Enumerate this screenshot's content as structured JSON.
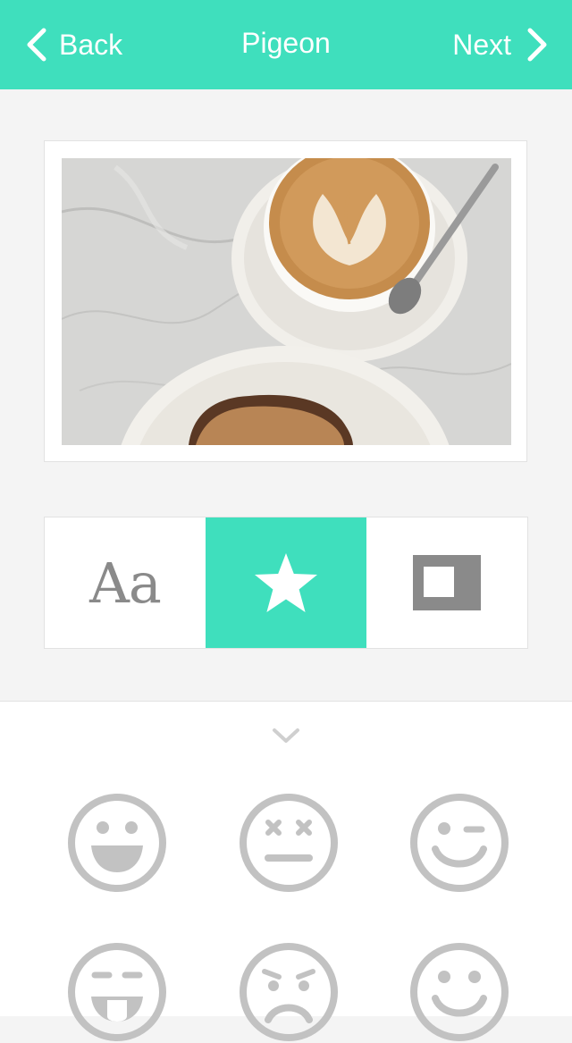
{
  "nav": {
    "back_label": "Back",
    "title": "Pigeon",
    "next_label": "Next"
  },
  "colors": {
    "accent": "#3fdfbd",
    "icon_gray": "#c2c2c2",
    "tool_gray": "#8a8a8a"
  },
  "tools": {
    "text_label": "Aa",
    "items": [
      "text-tool",
      "sticker-tool",
      "frame-tool"
    ],
    "active": "sticker-tool"
  },
  "stickers": {
    "items": [
      "grin-emoji",
      "dizzy-emoji",
      "wink-emoji",
      "tongue-emoji",
      "frown-emoji",
      "smile-emoji"
    ]
  }
}
